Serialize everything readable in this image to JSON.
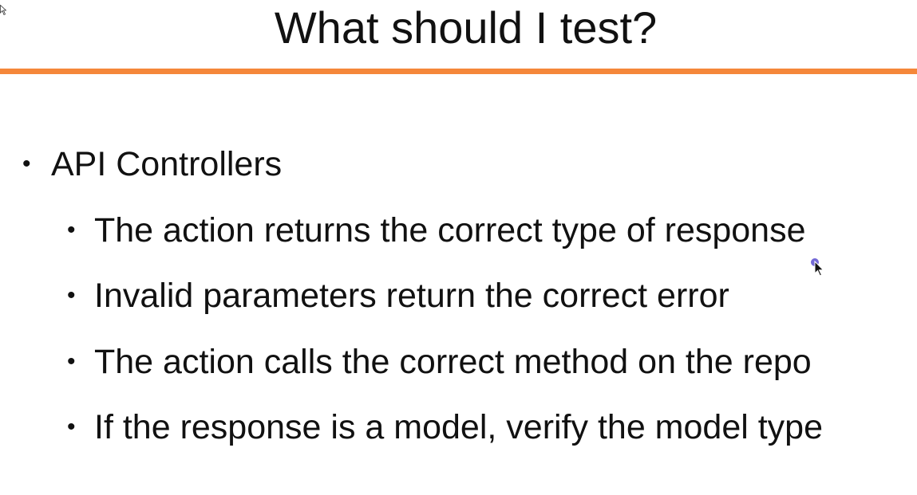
{
  "slide": {
    "title": "What should I test?",
    "accent_color": "#f5873a",
    "bullets": [
      {
        "text": "API Controllers",
        "children": [
          "The action returns the correct type of response",
          "Invalid parameters return the correct error",
          "The action calls the correct method on the repo",
          "If the response is a model, verify the model type"
        ]
      }
    ],
    "bullet_glyph": "•"
  },
  "icons": {
    "mouse_cursor": "arrow-pointer-icon",
    "cursor_highlight_color": "#5a4fcf"
  }
}
